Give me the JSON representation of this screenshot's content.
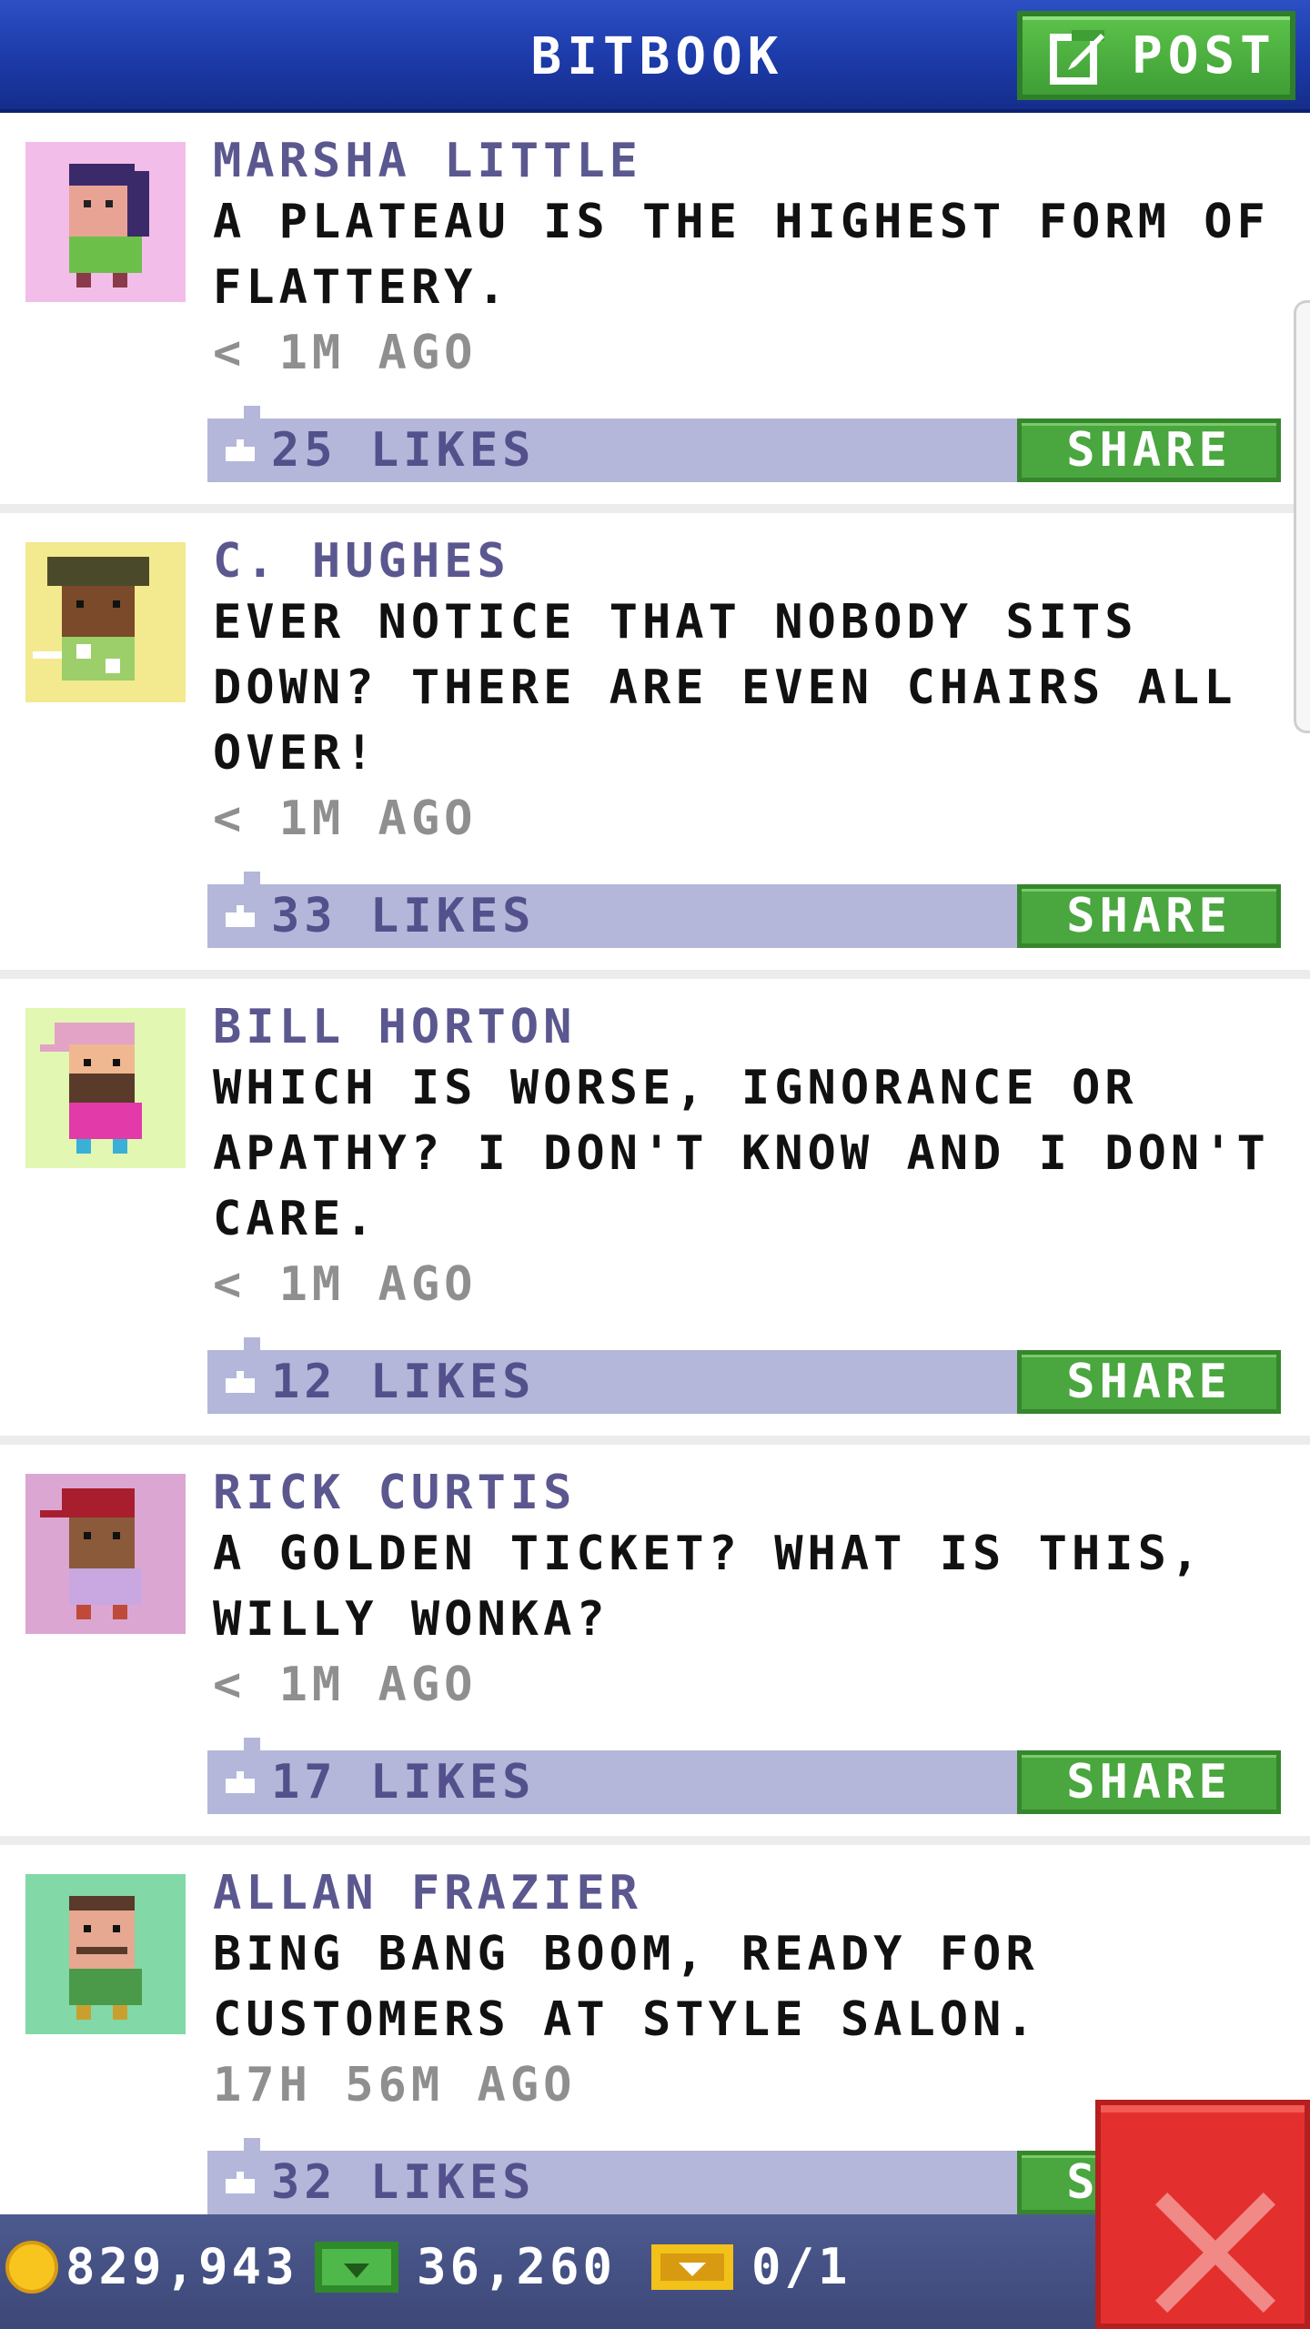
{
  "header": {
    "title": "BITBOOK",
    "post_label": "POST"
  },
  "posts": [
    {
      "author": "MARSHA LITTLE",
      "message": "A PLATEAU IS THE HIGHEST FORM OF FLATTERY.",
      "time": "< 1M AGO",
      "likes": "25 LIKES",
      "share_label": "SHARE",
      "avatar_bg": "#f3bde9"
    },
    {
      "author": "C. HUGHES",
      "message": "EVER NOTICE THAT NOBODY SITS DOWN? THERE ARE EVEN CHAIRS ALL OVER!",
      "time": "< 1M AGO",
      "likes": "33 LIKES",
      "share_label": "SHARE",
      "avatar_bg": "#f3e98f"
    },
    {
      "author": "BILL HORTON",
      "message": "WHICH IS WORSE, IGNORANCE OR APATHY? I DON'T KNOW AND I DON'T CARE.",
      "time": "< 1M AGO",
      "likes": "12 LIKES",
      "share_label": "SHARE",
      "avatar_bg": "#e2f7b2"
    },
    {
      "author": "RICK CURTIS",
      "message": "A GOLDEN TICKET? WHAT IS THIS, WILLY WONKA?",
      "time": "< 1M AGO",
      "likes": "17 LIKES",
      "share_label": "SHARE",
      "avatar_bg": "#dca6d2"
    },
    {
      "author": "ALLAN FRAZIER",
      "message": "BING BANG BOOM, READY FOR CUSTOMERS AT STYLE SALON.",
      "time": "17H 56M AGO",
      "likes": "32 LIKES",
      "share_label": "SHARE",
      "avatar_bg": "#82d8a6"
    }
  ],
  "footer": {
    "coins": "829,943",
    "bux": "36,260",
    "tickets": "0/1"
  },
  "colors": {
    "header_blue": "#1c3aa8",
    "like_bar": "#b4b7d9",
    "share_green": "#4aa63e",
    "close_red": "#e3302f",
    "footer_bg": "#4d5a8f"
  },
  "icons": {
    "post": "edit-icon",
    "like": "thumbs-up-icon",
    "coin": "coin-icon",
    "bux": "cash-icon",
    "ticket": "golden-ticket-icon",
    "close": "close-icon"
  }
}
